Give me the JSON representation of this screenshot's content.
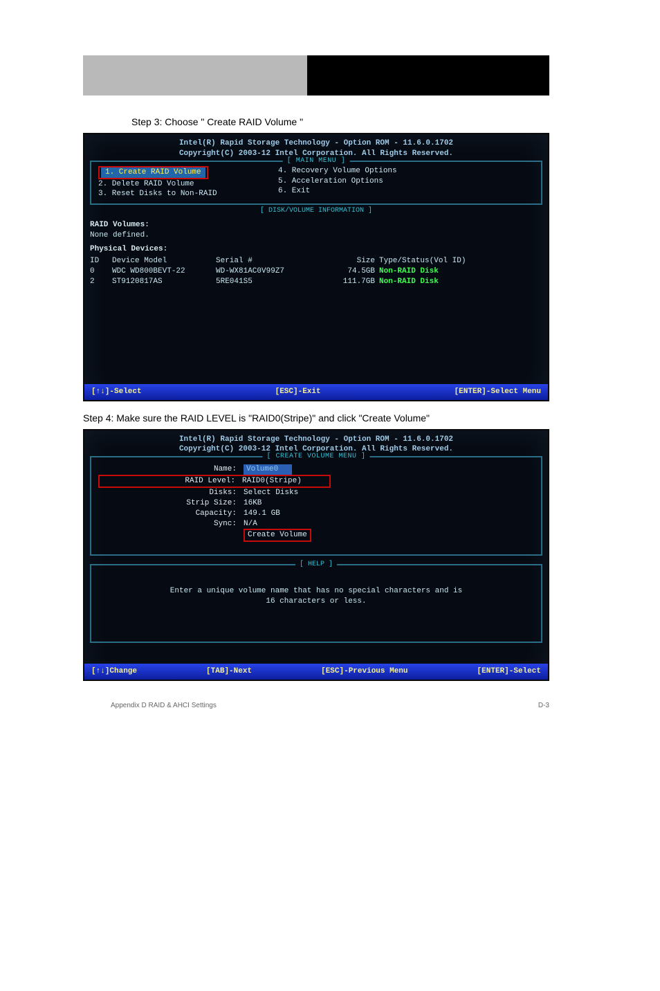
{
  "header": {
    "black_text": ""
  },
  "step3": {
    "prefix": "Step 3: Choose \"",
    "option": "Create RAID Volume",
    "suffix": "\""
  },
  "bios1": {
    "title1": "Intel(R) Rapid Storage Technology - Option ROM - 11.6.0.1702",
    "title2": "Copyright(C) 2003-12 Intel Corporation.  All Rights Reserved.",
    "main_menu_label": "[ MAIN MENU ]",
    "menu": {
      "i1": "1.  Create RAID Volume",
      "i2": "2.  Delete RAID Volume",
      "i3": "3.  Reset Disks to Non-RAID",
      "i4": "4.  Recovery Volume Options",
      "i5": "5.  Acceleration Options",
      "i6": "6.  Exit"
    },
    "disk_info_label": "[ DISK/VOLUME INFORMATION ]",
    "raid_volumes_label": "RAID Volumes:",
    "none_defined": "None defined.",
    "physical_devices_label": "Physical Devices:",
    "headers": {
      "id": "ID",
      "model": "Device Model",
      "serial": "Serial #",
      "size": "Size",
      "type": "Type/Status(Vol ID)"
    },
    "devices": [
      {
        "id": "0",
        "model": "WDC WD800BEVT-22",
        "serial": "WD-WX81AC0V99Z7",
        "size": "74.5GB",
        "status": "Non-RAID Disk"
      },
      {
        "id": "2",
        "model": "ST9120817AS",
        "serial": "5RE041S5",
        "size": "111.7GB",
        "status": "Non-RAID Disk"
      }
    ],
    "footer": {
      "select": "[↑↓]-Select",
      "exit": "[ESC]-Exit",
      "menu": "[ENTER]-Select Menu"
    }
  },
  "step4": {
    "text": "Step 4: Make sure the RAID LEVEL is \"RAID0(Stripe)\" and click \"Create Volume\""
  },
  "bios2": {
    "title1": "Intel(R) Rapid Storage Technology - Option ROM - 11.6.0.1702",
    "title2": "Copyright(C) 2003-12 Intel Corporation.  All Rights Reserved.",
    "create_menu_label": "[ CREATE VOLUME MENU ]",
    "fields": {
      "name_label": "Name:",
      "name_val": "Volume0",
      "raid_label": "RAID Level:",
      "raid_val": "RAID0(Stripe)",
      "disks_label": "Disks:",
      "disks_val": "Select Disks",
      "strip_label": "Strip Size:",
      "strip_val": "16KB",
      "cap_label": "Capacity:",
      "cap_val": "149.1  GB",
      "sync_label": "Sync:",
      "sync_val": "N/A",
      "create_btn": "Create Volume"
    },
    "help_label": "[ HELP ]",
    "help_text1": "Enter a unique volume name that has no special characters and is",
    "help_text2": "16 characters or less.",
    "footer": {
      "change": "[↑↓]Change",
      "next": "[TAB]-Next",
      "prev": "[ESC]-Previous Menu",
      "sel": "[ENTER]-Select"
    }
  },
  "page_footer": {
    "left": "Appendix D RAID & AHCI Settings",
    "right": "D-3"
  }
}
